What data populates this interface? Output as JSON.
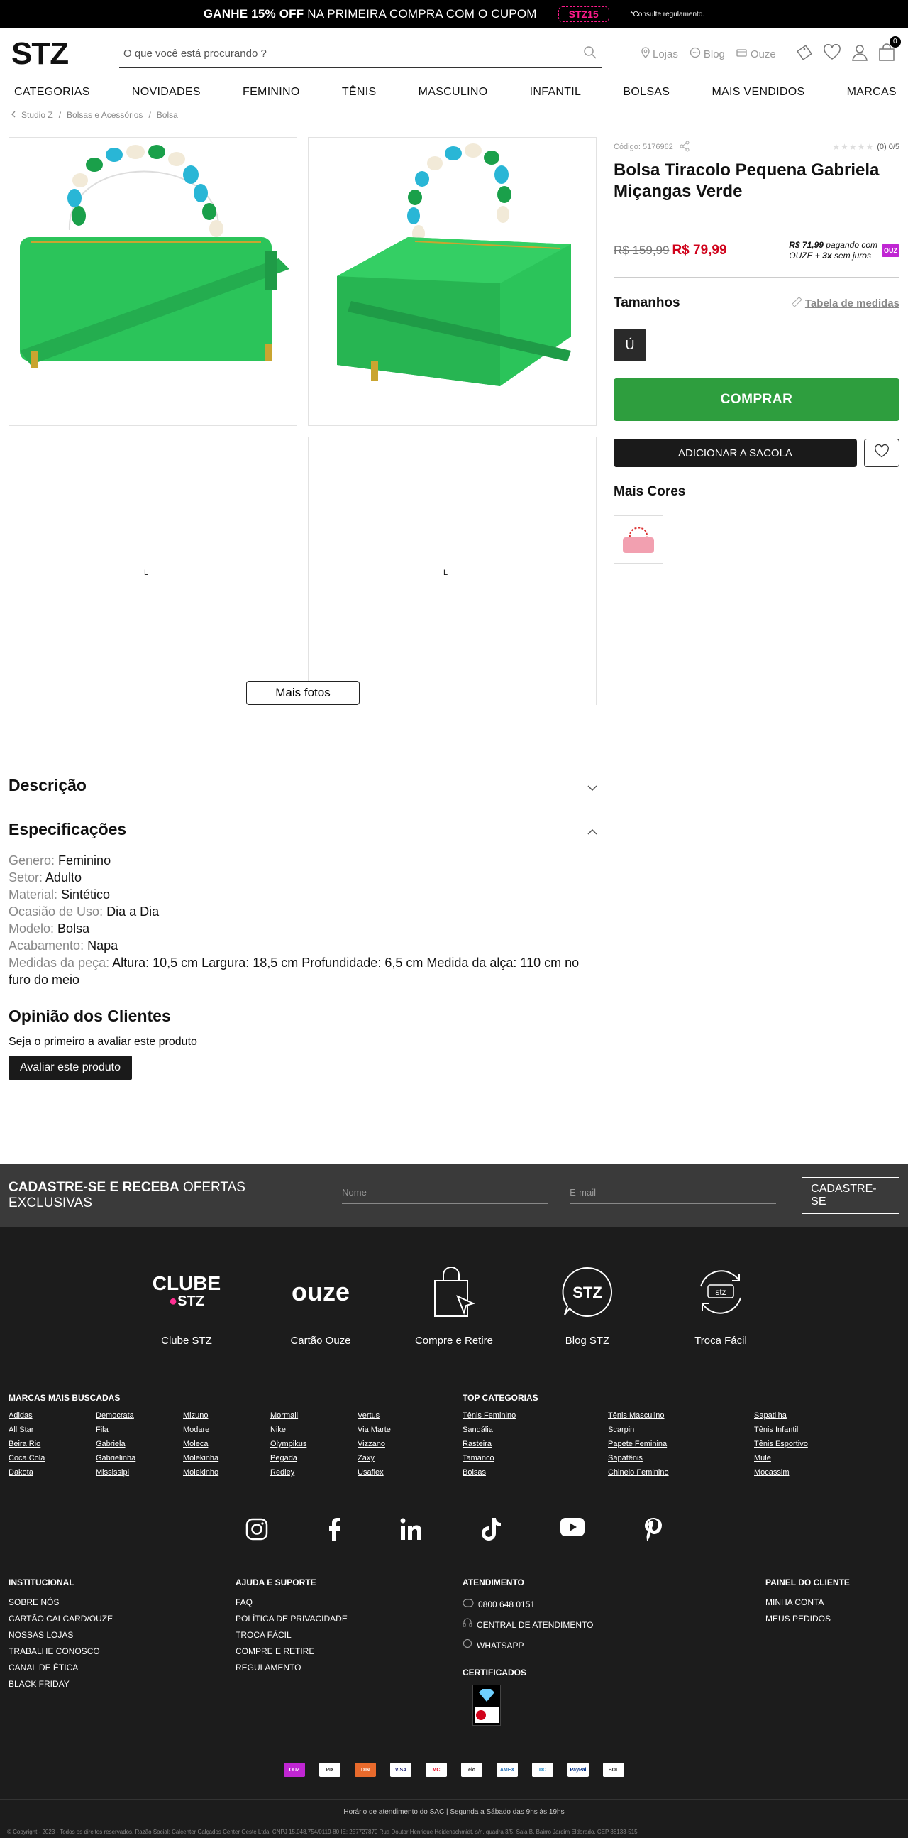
{
  "promo": {
    "prefix": "GANHE 15% OFF",
    "text": "NA PRIMEIRA COMPRA COM O CUPOM",
    "coupon": "STZ15",
    "note": "*Consulte regulamento."
  },
  "header": {
    "logo": "STZ",
    "search_placeholder": "O que você está procurando ?",
    "links": [
      "Lojas",
      "Blog",
      "Ouze"
    ],
    "bag_count": "0"
  },
  "nav": [
    "CATEGORIAS",
    "NOVIDADES",
    "FEMININO",
    "TÊNIS",
    "MASCULINO",
    "INFANTIL",
    "BOLSAS",
    "MAIS VENDIDOS",
    "MARCAS"
  ],
  "breadcrumb": [
    "Studio Z",
    "Bolsas e Acessórios",
    "Bolsa"
  ],
  "gallery": {
    "loading": "L",
    "more_photos": "Mais fotos"
  },
  "product": {
    "code": "Código: 5176962",
    "rating": "(0) 0/5",
    "title": "Bolsa Tiracolo Pequena Gabriela Miçangas Verde",
    "old_price": "R$ 159,99",
    "price": "R$ 79,99",
    "ouze_line1_price": "R$ 71,99",
    "ouze_line1_text": " pagando com",
    "ouze_line2_text": "OUZE + ",
    "ouze_installments": "3x",
    "ouze_line2_end": " sem juros",
    "ouze_badge": "OUZ",
    "sizes_title": "Tamanhos",
    "size_table": "Tabela de medidas",
    "size": "Ú",
    "buy": "COMPRAR",
    "add_to_bag": "ADICIONAR A SACOLA",
    "more_colors": "Mais Cores"
  },
  "colors": {
    "main_bag": "#2bc45a",
    "beads_teal": "#29b6d6",
    "beads_green": "#1aa04a",
    "beads_cream": "#f2ead8",
    "pink_bag": "#f2a0b0",
    "buy_green": "#2e9e3e",
    "price_red": "#d0021b"
  },
  "details": {
    "description_title": "Descrição",
    "specs_title": "Especificações",
    "specs": [
      {
        "k": "Genero: ",
        "v": "Feminino"
      },
      {
        "k": "Setor: ",
        "v": "Adulto"
      },
      {
        "k": "Material: ",
        "v": "Sintético"
      },
      {
        "k": "Ocasião de Uso: ",
        "v": "Dia a Dia"
      },
      {
        "k": "Modelo: ",
        "v": "Bolsa"
      },
      {
        "k": "Acabamento: ",
        "v": "Napa"
      },
      {
        "k": "Medidas da peça: ",
        "v": "Altura: 10,5 cm Largura: 18,5 cm Profundidade: 6,5 cm Medida da alça: 110 cm no furo do meio"
      }
    ],
    "reviews_title": "Opinião dos Clientes",
    "reviews_text": "Seja o primeiro a avaliar este produto",
    "reviews_button": "Avaliar este produto"
  },
  "newsletter": {
    "title_bold": "CADASTRE-SE E RECEBA",
    "title_rest": " OFERTAS EXCLUSIVAS",
    "name_placeholder": "Nome",
    "email_placeholder": "E-mail",
    "button": "CADASTRE-SE"
  },
  "features": [
    {
      "label": "Clube STZ",
      "art_top": "CLUBE",
      "art_bottom": "STZ"
    },
    {
      "label": "Cartão Ouze",
      "art": "ouze"
    },
    {
      "label": "Compre e Retire"
    },
    {
      "label": "Blog STZ",
      "art": "STZ"
    },
    {
      "label": "Troca Fácil",
      "art": "stz"
    }
  ],
  "brands": {
    "title": "MARCAS MAIS BUSCADAS",
    "columns": [
      [
        "Adidas",
        "All Star",
        "Beira Rio",
        "Coca Cola",
        "Dakota"
      ],
      [
        "Democrata",
        "Fila",
        "Gabriela",
        "Gabrielinha",
        "Mississipi"
      ],
      [
        "Mizuno",
        "Modare",
        "Moleca",
        "Molekinha",
        "Molekinho"
      ],
      [
        "Mormaii",
        "Nike",
        "Olympikus",
        "Pegada",
        "Redley"
      ],
      [
        "Vertus",
        "Via Marte",
        "Vizzano",
        "Zaxy",
        "Usaflex"
      ]
    ]
  },
  "categories": {
    "title": "TOP CATEGORIAS",
    "columns": [
      [
        "Tênis Feminino",
        "Sandália",
        "Rasteira",
        "Tamanco",
        "Bolsas"
      ],
      [
        "Tênis Masculino",
        "Scarpin",
        "Papete Feminina",
        "Sapatênis",
        "Chinelo Feminino"
      ],
      [
        "Sapatilha",
        "Tênis Infantil",
        "Tênis Esportivo",
        "Mule",
        "Mocassim"
      ]
    ]
  },
  "footer": {
    "institucional": {
      "title": "INSTITUCIONAL",
      "items": [
        "SOBRE NÓS",
        "CARTÃO CALCARD/OUZE",
        "NOSSAS LOJAS",
        "TRABALHE CONOSCO",
        "CANAL DE ÉTICA",
        "BLACK FRIDAY"
      ]
    },
    "ajuda": {
      "title": "AJUDA E SUPORTE",
      "items": [
        "FAQ",
        "POLÍTICA DE PRIVACIDADE",
        "TROCA FÁCIL",
        "COMPRE E RETIRE",
        "REGULAMENTO"
      ]
    },
    "atendimento": {
      "title": "ATENDIMENTO",
      "items": [
        "0800 648 0151",
        "CENTRAL DE ATENDIMENTO",
        "WHATSAPP"
      ]
    },
    "certificados": "CERTIFICADOS",
    "painel": {
      "title": "PAINEL DO CLIENTE",
      "items": [
        "MINHA CONTA",
        "MEUS PEDIDOS"
      ]
    },
    "payments": [
      "OUZ",
      "PIX",
      "DIN",
      "VISA",
      "MC",
      "elo",
      "AMEX",
      "DC",
      "PayPal",
      "BOL"
    ],
    "sac": "Horário de atendimento do SAC | Segunda a Sábado das 9hs às 19hs",
    "copyright": "© Copyright - 2023 - Todos os direitos reservados. Razão Social: Calcenter Calçados Center Oeste Ltda. CNPJ 15.048.754/0119-80 IE: 257727870 Rua Doutor Henrique Heidenschmidt, s/n, quadra 3/5, Sala B, Bairro Jardim Eldorado, CEP 88133-515"
  }
}
